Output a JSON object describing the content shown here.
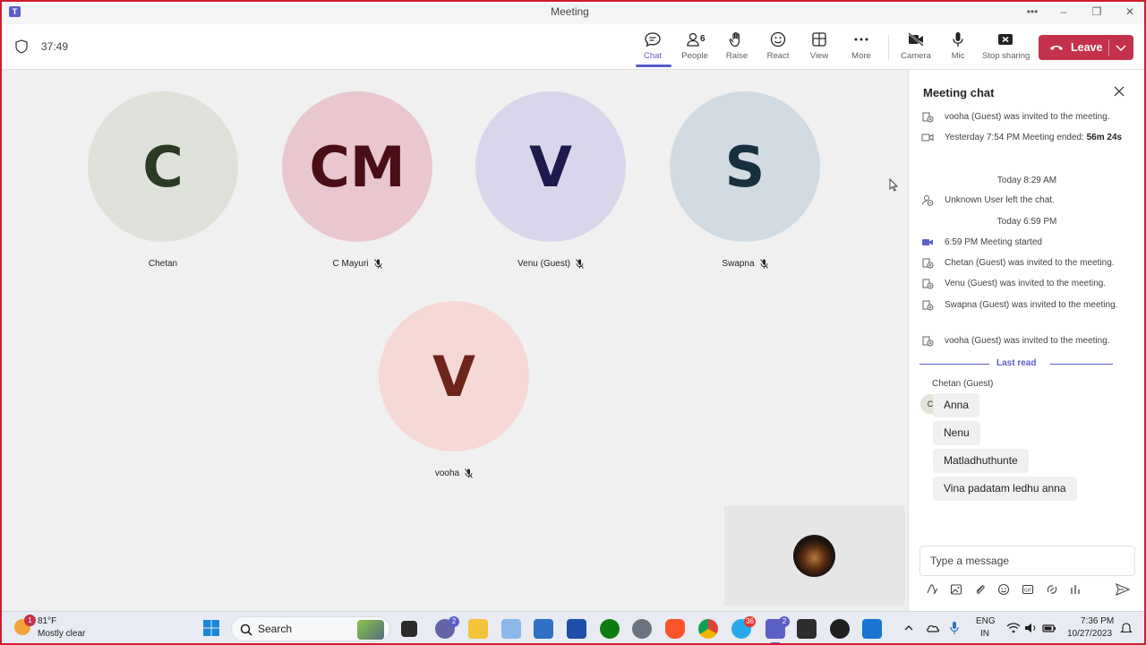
{
  "window": {
    "title": "Meeting"
  },
  "toolbar": {
    "timer": "37:49",
    "chat_label": "Chat",
    "people_label": "People",
    "people_count": "6",
    "raise_label": "Raise",
    "react_label": "React",
    "view_label": "View",
    "more_label": "More",
    "camera_label": "Camera",
    "mic_label": "Mic",
    "stop_sharing_label": "Stop sharing",
    "leave_label": "Leave"
  },
  "participants": [
    {
      "initials": "C",
      "name": "Chetan",
      "bg": "#dfe2da",
      "fg": "#2b3a22",
      "muted": false
    },
    {
      "initials": "CM",
      "name": "C Mayuri",
      "bg": "#e8c7ce",
      "fg": "#4a0e16",
      "muted": true
    },
    {
      "initials": "V",
      "name": "Venu (Guest)",
      "bg": "#d9d6eb",
      "fg": "#1e1a4d",
      "muted": true
    },
    {
      "initials": "S",
      "name": "Swapna",
      "bg": "#d2dbe2",
      "fg": "#17303d",
      "muted": true
    },
    {
      "initials": "V",
      "name": "vooha",
      "bg": "#f6d8d6",
      "fg": "#6e2419",
      "muted": true
    }
  ],
  "chat": {
    "title": "Meeting chat",
    "events": [
      {
        "icon": "person-add-icon",
        "text": "vooha (Guest) was invited to the meeting."
      },
      {
        "icon": "video-icon",
        "text": "Yesterday 7:54 PM   Meeting ended: ",
        "bold": "56m 24s"
      },
      {
        "icon": "person-leave-icon",
        "text": "Unknown User left the chat."
      },
      {
        "icon": "video-filled-icon",
        "text": "6:59 PM   Meeting started"
      },
      {
        "icon": "person-add-icon",
        "text": "Chetan (Guest) was invited to the meeting."
      },
      {
        "icon": "person-add-icon",
        "text": "Venu (Guest) was invited to the meeting."
      },
      {
        "icon": "person-add-icon",
        "text": "Swapna (Guest) was invited to the meeting."
      },
      {
        "icon": "person-add-icon",
        "text": "vooha (Guest) was invited to the meeting."
      }
    ],
    "timestamps": [
      "Today 8:29 AM",
      "Today 6:59 PM"
    ],
    "last_read_label": "Last read",
    "sender": "Chetan (Guest)",
    "sender_initial": "C",
    "messages": [
      "Anna",
      "Nenu",
      "Matladhuthunte",
      "Vina padatam ledhu anna"
    ],
    "compose_placeholder": "Type a message"
  },
  "taskbar": {
    "weather_temp": "81°F",
    "weather_desc": "Mostly clear",
    "weather_badge": "1",
    "search_placeholder": "Search",
    "teams_chat_badge": "2",
    "telegram_badge": "36",
    "teams_badge": "2",
    "lang_top": "ENG",
    "lang_bottom": "IN",
    "time": "7:36 PM",
    "date": "10/27/2023"
  },
  "colors": {
    "accent": "#5b5fc7",
    "leave": "#c4314b",
    "frame": "#d21d2c"
  }
}
